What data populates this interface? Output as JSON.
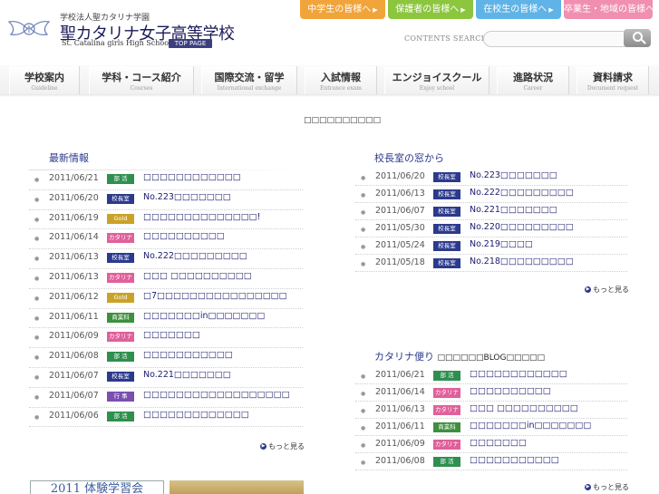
{
  "header": {
    "school_sub": "学校法人聖カタリナ学園",
    "school_name": "聖カタリナ女子高等学校",
    "school_en": "St. Catalina girls High School",
    "top_page": "TOP PAGE",
    "top_buttons": [
      {
        "label": "中学生の皆様へ",
        "color": "#f0a43a"
      },
      {
        "label": "保護者の皆様へ",
        "color": "#8cc63f"
      },
      {
        "label": "在校生の皆様へ",
        "color": "#5fb3e6"
      },
      {
        "label": "卒業生・地域の皆様へ",
        "color": "#f08fb0"
      }
    ],
    "arrow": "▶",
    "contents_search": "CONTENTS SEARCH",
    "search_placeholder": ""
  },
  "nav": [
    {
      "jp": "学校案内",
      "en": "Guideline"
    },
    {
      "jp": "学科・コース紹介",
      "en": "Courses"
    },
    {
      "jp": "国際交流・留学",
      "en": "International exchange"
    },
    {
      "jp": "入試情報",
      "en": "Entrance exam"
    },
    {
      "jp": "エンジョイスクール",
      "en": "Enjoy school"
    },
    {
      "jp": "進路状況",
      "en": "Career"
    },
    {
      "jp": "資料請求",
      "en": "Document request"
    }
  ],
  "notice": "□□□□□□□□□□",
  "badge_colors": {
    "部活": "#2f8f4f",
    "校長室": "#2b3a8c",
    "Gold": "#c9a227",
    "カタリナ": "#e0609a",
    "商業科": "#3e8f3e",
    "行事": "#7a4fb0"
  },
  "latest": {
    "title": "最新情報",
    "more": "もっと見る",
    "items": [
      {
        "date": "2011/06/21",
        "badge": "部 活",
        "badge_key": "部活",
        "title": "□□□□□□□□□□□□"
      },
      {
        "date": "2011/06/20",
        "badge": "校長室",
        "badge_key": "校長室",
        "title": "No.223□□□□□□□"
      },
      {
        "date": "2011/06/19",
        "badge": "Gold",
        "badge_key": "Gold",
        "title": "□□□□□□□□□□□□□□!"
      },
      {
        "date": "2011/06/14",
        "badge": "カタリナ",
        "badge_key": "カタリナ",
        "title": "□□□□□□□□□□"
      },
      {
        "date": "2011/06/13",
        "badge": "校長室",
        "badge_key": "校長室",
        "title": "No.222□□□□□□□□□"
      },
      {
        "date": "2011/06/13",
        "badge": "カタリナ",
        "badge_key": "カタリナ",
        "title": "□□□ □□□□□□□□□□"
      },
      {
        "date": "2011/06/12",
        "badge": "Gold",
        "badge_key": "Gold",
        "title": "□7□□□□□□□□□□□□□□□□"
      },
      {
        "date": "2011/06/11",
        "badge": "商業科",
        "badge_key": "商業科",
        "title": "□□□□□□□in□□□□□□□"
      },
      {
        "date": "2011/06/09",
        "badge": "カタリナ",
        "badge_key": "カタリナ",
        "title": "□□□□□□□"
      },
      {
        "date": "2011/06/08",
        "badge": "部 活",
        "badge_key": "部活",
        "title": "□□□□□□□□□□□"
      },
      {
        "date": "2011/06/07",
        "badge": "校長室",
        "badge_key": "校長室",
        "title": "No.221□□□□□□□"
      },
      {
        "date": "2011/06/07",
        "badge": "行 事",
        "badge_key": "行事",
        "title": "□□□□□□□□□□□□□□□□□□"
      },
      {
        "date": "2011/06/06",
        "badge": "部 活",
        "badge_key": "部活",
        "title": "□□□□□□□□□□□□□"
      }
    ]
  },
  "principal": {
    "title": "校長室の窓から",
    "more": "もっと見る",
    "items": [
      {
        "date": "2011/06/20",
        "badge": "校長室",
        "badge_key": "校長室",
        "title": "No.223□□□□□□□"
      },
      {
        "date": "2011/06/13",
        "badge": "校長室",
        "badge_key": "校長室",
        "title": "No.222□□□□□□□□□"
      },
      {
        "date": "2011/06/07",
        "badge": "校長室",
        "badge_key": "校長室",
        "title": "No.221□□□□□□□"
      },
      {
        "date": "2011/05/30",
        "badge": "校長室",
        "badge_key": "校長室",
        "title": "No.220□□□□□□□□□"
      },
      {
        "date": "2011/05/24",
        "badge": "校長室",
        "badge_key": "校長室",
        "title": "No.219□□□□"
      },
      {
        "date": "2011/05/18",
        "badge": "校長室",
        "badge_key": "校長室",
        "title": "No.218□□□□□□□□□"
      }
    ]
  },
  "catalina": {
    "title": "カタリナ便り",
    "subtitle": "□□□□□□BLOG□□□□□",
    "more": "もっと見る",
    "items": [
      {
        "date": "2011/06/21",
        "badge": "部 活",
        "badge_key": "部活",
        "title": "□□□□□□□□□□□□"
      },
      {
        "date": "2011/06/14",
        "badge": "カタリナ",
        "badge_key": "カタリナ",
        "title": "□□□□□□□□□□"
      },
      {
        "date": "2011/06/13",
        "badge": "カタリナ",
        "badge_key": "カタリナ",
        "title": "□□□ □□□□□□□□□□"
      },
      {
        "date": "2011/06/11",
        "badge": "商業科",
        "badge_key": "商業科",
        "title": "□□□□□□□in□□□□□□□"
      },
      {
        "date": "2011/06/09",
        "badge": "カタリナ",
        "badge_key": "カタリナ",
        "title": "□□□□□□□"
      },
      {
        "date": "2011/06/08",
        "badge": "部 活",
        "badge_key": "部活",
        "title": "□□□□□□□□□□□"
      }
    ]
  },
  "banner": {
    "label": "2011 体験学習会"
  }
}
